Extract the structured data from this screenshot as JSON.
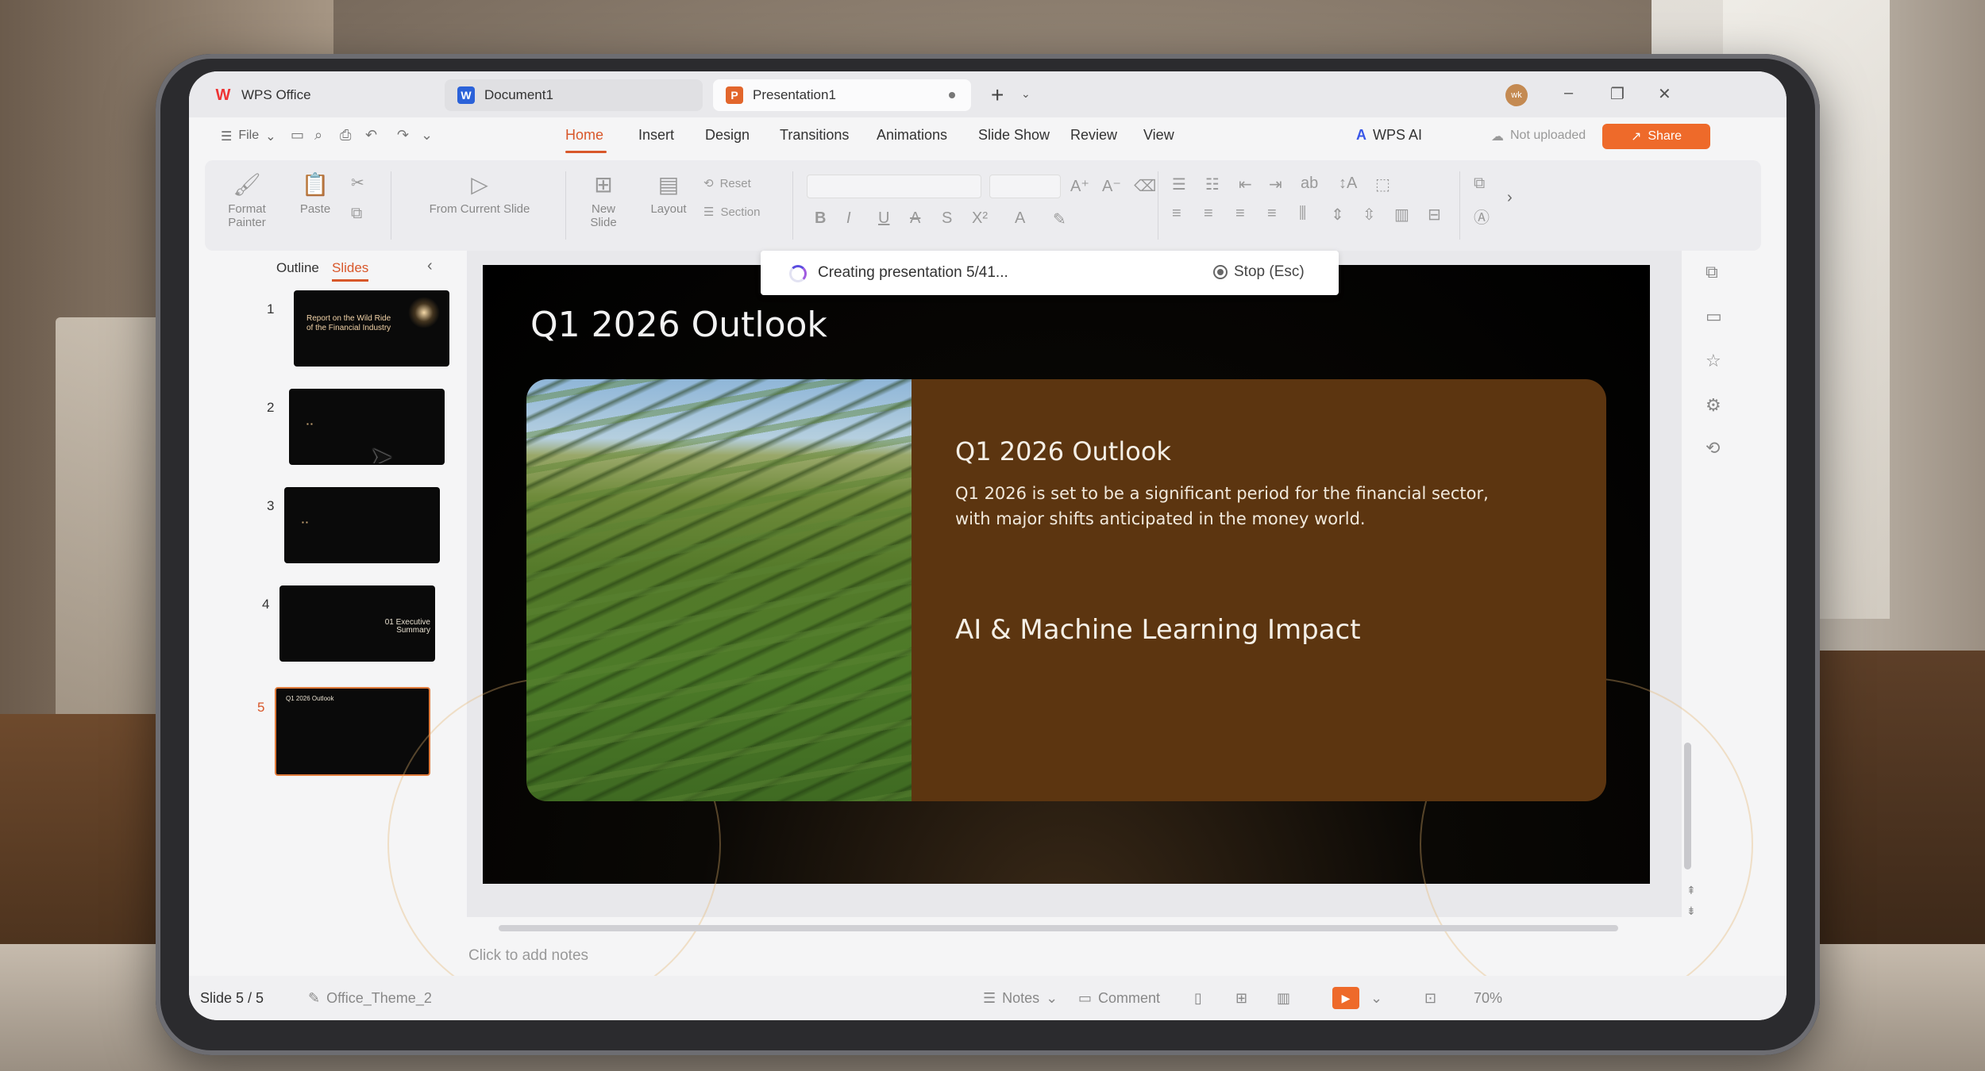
{
  "tabs": {
    "app": "WPS Office",
    "doc": "Document1",
    "ppt": "Presentation1",
    "avatar_text": "wk"
  },
  "menu": {
    "file": "File",
    "items": [
      "Home",
      "Insert",
      "Design",
      "Transitions",
      "Animations",
      "Slide Show",
      "Review",
      "View"
    ],
    "active": "Home",
    "wps_ai": "WPS AI",
    "not_uploaded": "Not uploaded",
    "share": "Share"
  },
  "ribbon": {
    "format_painter": "Format Painter",
    "paste": "Paste",
    "from_current_slide": "From Current Slide",
    "new_slide": "New Slide",
    "layout": "Layout",
    "reset": "Reset",
    "section": "Section"
  },
  "panel": {
    "outline": "Outline",
    "slides": "Slides",
    "thumbnails": [
      {
        "num": "1",
        "text": "Report on the Wild Ride of the Financial Industry"
      },
      {
        "num": "2",
        "text": ""
      },
      {
        "num": "3",
        "text": ""
      },
      {
        "num": "4",
        "text": "01 Executive Summary"
      },
      {
        "num": "5",
        "text": "Q1 2026 Outlook"
      }
    ],
    "active_slide": 5
  },
  "toast": {
    "message": "Creating presentation 5/41...",
    "stop": "Stop (Esc)"
  },
  "slide": {
    "title": "Q1 2026 Outlook",
    "card_heading": "Q1 2026 Outlook",
    "card_body": "Q1 2026 is set to be a significant period for the financial sector, with major shifts anticipated in the money world.",
    "card_sub": "AI & Machine Learning Impact"
  },
  "notes_placeholder": "Click to add notes",
  "status": {
    "slide": "Slide 5 / 5",
    "theme": "Office_Theme_2",
    "notes": "Notes",
    "comment": "Comment",
    "zoom": "70%"
  },
  "colors": {
    "accent": "#d8572a",
    "share": "#ee6a2a",
    "card": "#5c3510"
  }
}
